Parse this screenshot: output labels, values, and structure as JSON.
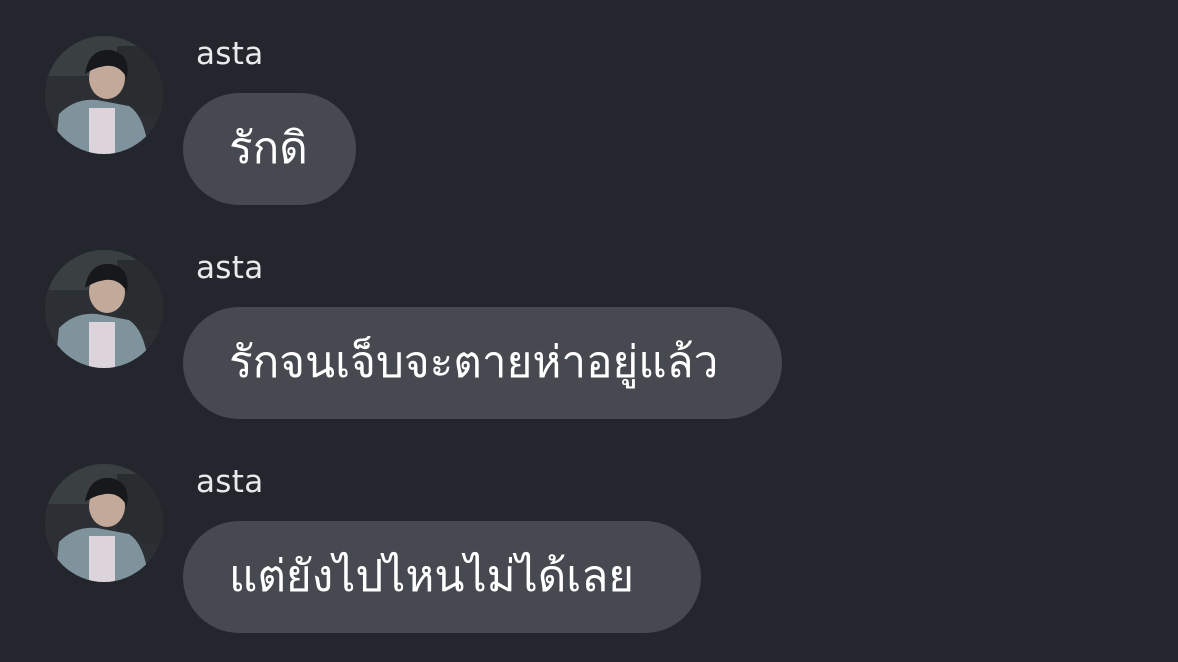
{
  "messages": [
    {
      "sender": "asta",
      "text": "รักดิ"
    },
    {
      "sender": "asta",
      "text": "รักจนเจ็บจะตายห่าอยู่แล้ว"
    },
    {
      "sender": "asta",
      "text": "แต่ยังไปไหนไม่ได้เลย"
    }
  ]
}
